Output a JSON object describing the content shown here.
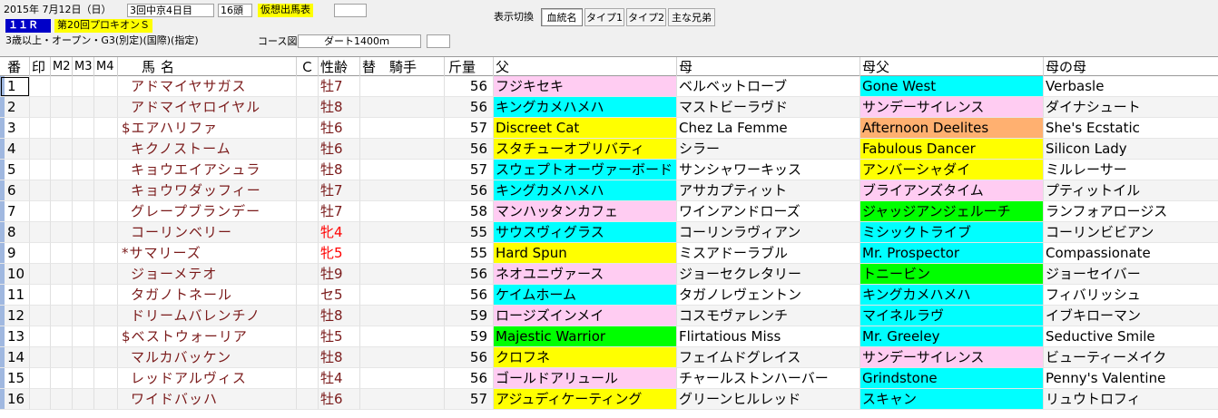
{
  "header": {
    "date": "2015年 7月12日（日）",
    "meeting": "3回中京4日目",
    "runners": "16頭",
    "status": "仮想出馬表",
    "race_no": "１１Ｒ",
    "race_name": "第20回プロキオンＳ",
    "conditions": "3歳以上・オープン・G3(別定)(国際)(指定)",
    "course_label": "コース図",
    "course": "ダート1400ｍ"
  },
  "toolbar": {
    "label": "表示切換",
    "buttons": [
      "血統名",
      "タイプ1",
      "タイプ2",
      "主な兄弟"
    ],
    "active": "血統名"
  },
  "columns": {
    "num": "番",
    "mark": "印",
    "m2": "M2",
    "m3": "M3",
    "m4": "M4",
    "name": "馬名",
    "c": "Ｃ",
    "sexage": "性齢",
    "change": "替",
    "jockey": "騎手",
    "weight": "斤量",
    "sire": "父",
    "dam": "母",
    "damsire": "母父",
    "granddam": "母の母"
  },
  "colors": {
    "pink": "#ffccf2",
    "cyan": "#00ffff",
    "yellow": "#ffff00",
    "green": "#00ff00",
    "orange": "#ffb070",
    "white": "#ffffff"
  },
  "rows": [
    {
      "num": "1",
      "name": "アドマイヤサガス",
      "sexage": "牡7",
      "sex_red": false,
      "weight": "56",
      "sire": "フジキセキ",
      "sire_bg": "pink",
      "dam": "ベルベットローブ",
      "damsire": "Gone West",
      "damsire_bg": "cyan",
      "granddam": "Verbasle"
    },
    {
      "num": "2",
      "name": "アドマイヤロイヤル",
      "sexage": "牡8",
      "sex_red": false,
      "weight": "56",
      "sire": "キングカメハメハ",
      "sire_bg": "cyan",
      "dam": "マストビーラヴド",
      "damsire": "サンデーサイレンス",
      "damsire_bg": "pink",
      "granddam": "ダイナシュート"
    },
    {
      "num": "3",
      "name": "$エアハリファ",
      "sexage": "牡6",
      "sex_red": false,
      "weight": "57",
      "sire": "Discreet Cat",
      "sire_bg": "yellow",
      "dam": "Chez La Femme",
      "damsire": "Afternoon Deelites",
      "damsire_bg": "orange",
      "granddam": "She's Ecstatic"
    },
    {
      "num": "4",
      "name": "キクノストーム",
      "sexage": "牡6",
      "sex_red": false,
      "weight": "56",
      "sire": "スタチューオブリバティ",
      "sire_bg": "yellow",
      "dam": "シラー",
      "damsire": "Fabulous Dancer",
      "damsire_bg": "yellow",
      "granddam": "Silicon Lady"
    },
    {
      "num": "5",
      "name": "キョウエイアシュラ",
      "sexage": "牡8",
      "sex_red": false,
      "weight": "57",
      "sire": "スウェプトオーヴァーボード",
      "sire_bg": "cyan",
      "dam": "サンシャワーキッス",
      "damsire": "アンバーシャダイ",
      "damsire_bg": "yellow",
      "granddam": "ミルレーサー"
    },
    {
      "num": "6",
      "name": "キョウワダッフィー",
      "sexage": "牡7",
      "sex_red": false,
      "weight": "56",
      "sire": "キングカメハメハ",
      "sire_bg": "cyan",
      "dam": "アサカプティット",
      "damsire": "ブライアンズタイム",
      "damsire_bg": "pink",
      "granddam": "プティットイル"
    },
    {
      "num": "7",
      "name": "グレープブランデー",
      "sexage": "牡7",
      "sex_red": false,
      "weight": "58",
      "sire": "マンハッタンカフェ",
      "sire_bg": "pink",
      "dam": "ワインアンドローズ",
      "damsire": "ジャッジアンジェルーチ",
      "damsire_bg": "green",
      "granddam": "ランフォアロージス"
    },
    {
      "num": "8",
      "name": "コーリンベリー",
      "sexage": "牝4",
      "sex_red": true,
      "weight": "55",
      "sire": "サウスヴィグラス",
      "sire_bg": "cyan",
      "dam": "コーリンラヴィアン",
      "damsire": "ミシックトライブ",
      "damsire_bg": "cyan",
      "granddam": "コーリンビビアン"
    },
    {
      "num": "9",
      "name": "*サマリーズ",
      "sexage": "牝5",
      "sex_red": true,
      "weight": "55",
      "sire": "Hard Spun",
      "sire_bg": "yellow",
      "dam": "ミスアドーラブル",
      "damsire": "Mr. Prospector",
      "damsire_bg": "cyan",
      "granddam": "Compassionate"
    },
    {
      "num": "10",
      "name": "ジョーメテオ",
      "sexage": "牡9",
      "sex_red": false,
      "weight": "56",
      "sire": "ネオユニヴァース",
      "sire_bg": "pink",
      "dam": "ジョーセクレタリー",
      "damsire": "トニービン",
      "damsire_bg": "green",
      "granddam": "ジョーセイバー"
    },
    {
      "num": "11",
      "name": "タガノトネール",
      "sexage": "セ5",
      "sex_red": false,
      "weight": "56",
      "sire": "ケイムホーム",
      "sire_bg": "cyan",
      "dam": "タガノレヴェントン",
      "damsire": "キングカメハメハ",
      "damsire_bg": "cyan",
      "granddam": "フィバリッシュ"
    },
    {
      "num": "12",
      "name": "ドリームバレンチノ",
      "sexage": "牡8",
      "sex_red": false,
      "weight": "59",
      "sire": "ロージズインメイ",
      "sire_bg": "pink",
      "dam": "コスモヴァレンチ",
      "damsire": "マイネルラヴ",
      "damsire_bg": "cyan",
      "granddam": "イブキローマン"
    },
    {
      "num": "13",
      "name": "$ベストウォーリア",
      "sexage": "牡5",
      "sex_red": false,
      "weight": "59",
      "sire": "Majestic Warrior",
      "sire_bg": "green",
      "dam": "Flirtatious Miss",
      "damsire": "Mr. Greeley",
      "damsire_bg": "cyan",
      "granddam": "Seductive Smile"
    },
    {
      "num": "14",
      "name": "マルカバッケン",
      "sexage": "牡8",
      "sex_red": false,
      "weight": "56",
      "sire": "クロフネ",
      "sire_bg": "yellow",
      "dam": "フェイムドグレイス",
      "damsire": "サンデーサイレンス",
      "damsire_bg": "pink",
      "granddam": "ビューティーメイク"
    },
    {
      "num": "15",
      "name": "レッドアルヴィス",
      "sexage": "牡4",
      "sex_red": false,
      "weight": "56",
      "sire": "ゴールドアリュール",
      "sire_bg": "pink",
      "dam": "チャールストンハーバー",
      "damsire": "Grindstone",
      "damsire_bg": "cyan",
      "granddam": "Penny's Valentine"
    },
    {
      "num": "16",
      "name": "ワイドバッハ",
      "sexage": "牡6",
      "sex_red": false,
      "weight": "57",
      "sire": "アジュディケーティング",
      "sire_bg": "yellow",
      "dam": "グリーンヒルレッド",
      "damsire": "スキャン",
      "damsire_bg": "cyan",
      "granddam": "リュウトロフィ"
    }
  ]
}
